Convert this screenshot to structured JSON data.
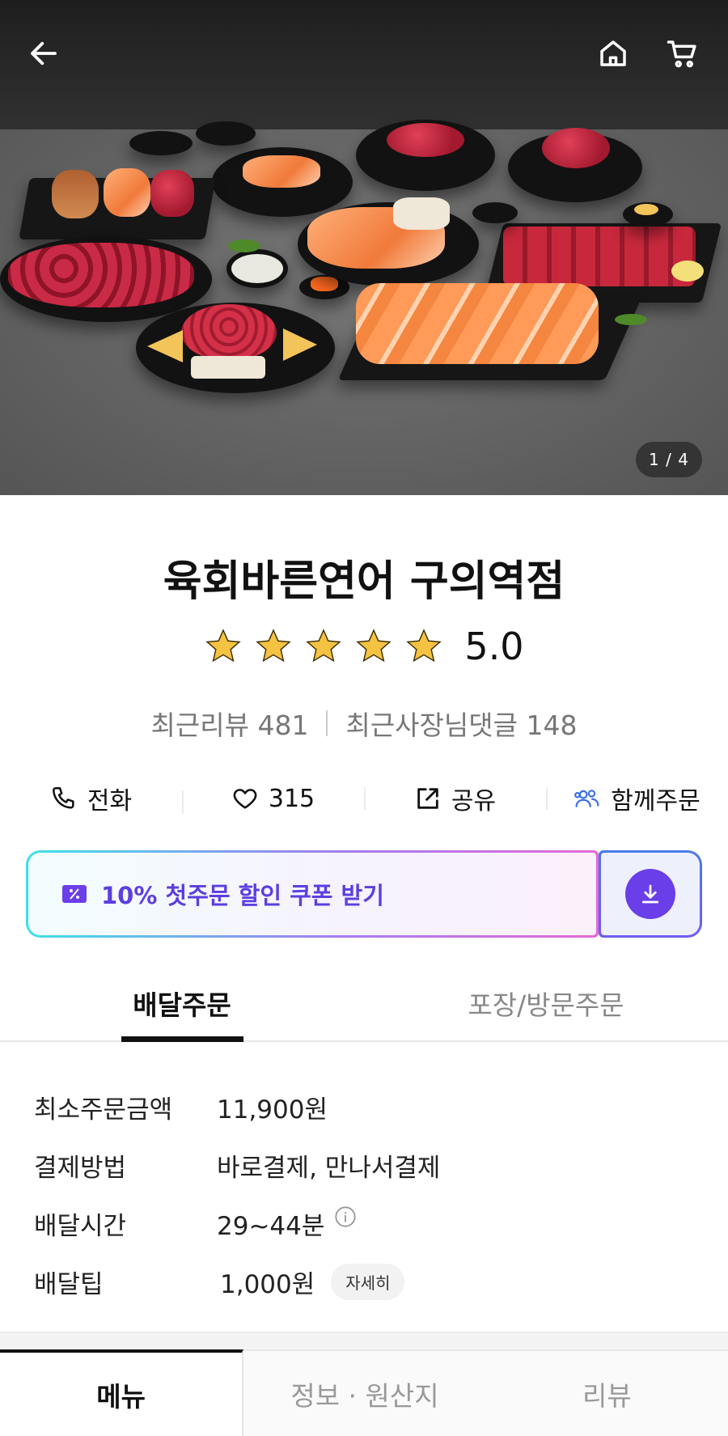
{
  "hero": {
    "page_indicator": "1 / 4",
    "icons": {
      "back": "back-arrow-icon",
      "home": "home-icon",
      "cart": "cart-icon"
    }
  },
  "store": {
    "name": "육회바른연어 구의역점",
    "rating": "5.0",
    "stars": 5,
    "recent_reviews": "최근리뷰 481",
    "owner_replies": "최근사장님댓글 148"
  },
  "actions": {
    "call": "전화",
    "like_count": "315",
    "share": "공유",
    "group_order": "함께주문"
  },
  "coupon": {
    "text": "10% 첫주문 할인 쿠폰 받기",
    "accent": "#5c3ee0"
  },
  "order_tabs": {
    "delivery": "배달주문",
    "pickup": "포장/방문주문"
  },
  "details": {
    "min_order_label": "최소주문금액",
    "min_order_value": "11,900원",
    "payment_label": "결제방법",
    "payment_value": "바로결제, 만나서결제",
    "delivery_time_label": "배달시간",
    "delivery_time_value": "29~44분",
    "delivery_tip_label": "배달팁",
    "delivery_tip_value": "1,000원",
    "detail_button": "자세히"
  },
  "bottom_tabs": {
    "menu": "메뉴",
    "info": "정보 · 원산지",
    "review": "리뷰"
  },
  "colors": {
    "star": "#f5c242",
    "coupon_purple": "#6a3ee8",
    "group_icon": "#3a6fe0"
  }
}
